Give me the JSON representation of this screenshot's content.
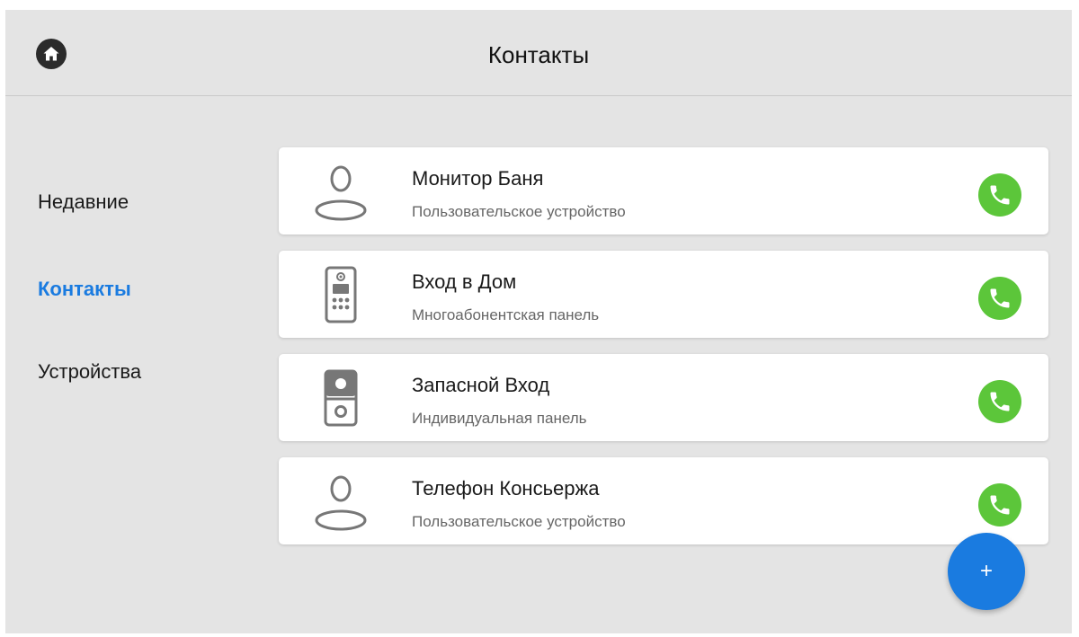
{
  "header": {
    "title": "Контакты",
    "home_icon": "home-icon"
  },
  "nav": {
    "items": [
      {
        "label": "Недавние",
        "active": false
      },
      {
        "label": "Контакты",
        "active": true
      },
      {
        "label": "Устройства",
        "active": false
      }
    ]
  },
  "contacts": [
    {
      "name": "Монитор Баня",
      "type": "Пользовательское устройство",
      "icon": "user-icon"
    },
    {
      "name": "Вход в Дом",
      "type": "Многоабонентская панель",
      "icon": "multi-apartment-panel-icon"
    },
    {
      "name": "Запасной Вход",
      "type": "Индивидуальная панель",
      "icon": "individual-panel-icon"
    },
    {
      "name": "Телефон Консьержа",
      "type": "Пользовательское устройство",
      "icon": "user-icon"
    }
  ],
  "fab": {
    "label": "+"
  },
  "colors": {
    "accent": "#1a7be0",
    "call": "#5cc63a",
    "background": "#e4e4e4"
  }
}
